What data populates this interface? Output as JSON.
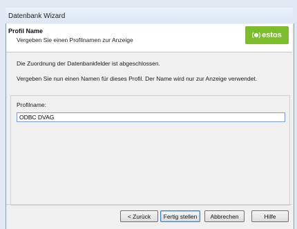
{
  "window": {
    "title": "Datenbank Wizard"
  },
  "header": {
    "title": "Profil Name",
    "subtitle": "Vergeben Sie einen Profilnamen zur Anzeige",
    "logo_text": "estos",
    "logo_color": "#7bbd2a"
  },
  "body": {
    "line1": "Die Zuordnung der Datenbankfelder ist abgeschlossen.",
    "line2": "Vergeben Sie nun einen Namen für dieses Profil. Der Name wird nur zur Anzeige verwendet.",
    "profile_label": "Profilname:",
    "profile_value": "ODBC DVAG"
  },
  "buttons": {
    "back": "< Zurück",
    "finish": "Fertig stellen",
    "cancel": "Abbrechen",
    "help": "Hilfe"
  }
}
